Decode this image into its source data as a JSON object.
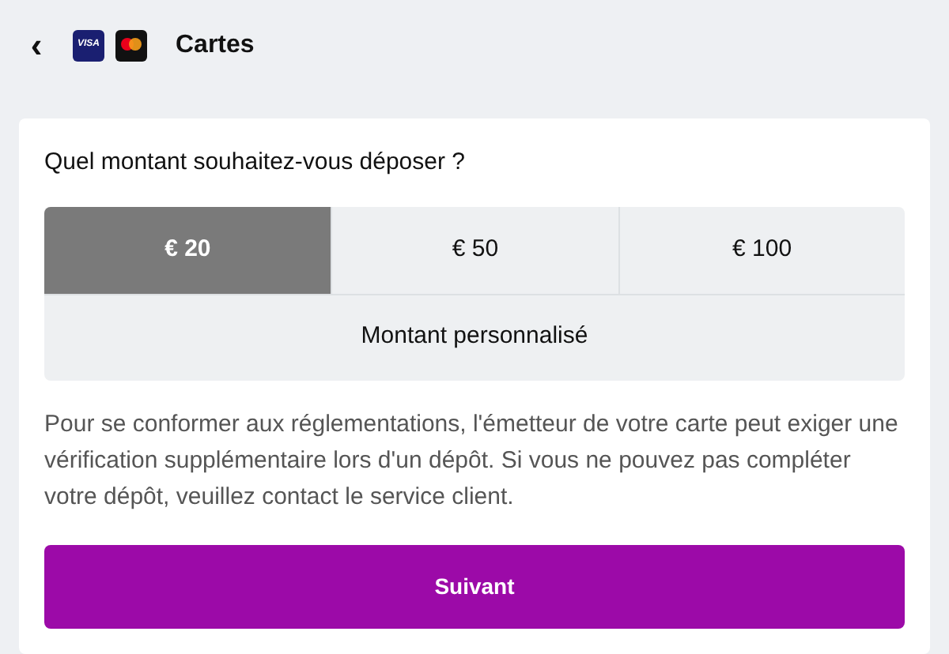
{
  "header": {
    "back": "‹",
    "brand_badge": "VISA",
    "title": "Cartes"
  },
  "question": "Quel montant souhaitez-vous déposer ?",
  "amounts": [
    {
      "label": "€ 20",
      "selected": true
    },
    {
      "label": "€ 50",
      "selected": false
    },
    {
      "label": "€ 100",
      "selected": false
    }
  ],
  "custom": {
    "label": "Montant personnalisé",
    "selected": false
  },
  "notice": "Pour se conformer aux réglementations, l'émetteur de votre carte peut exiger une vérification supplémentaire lors d'un dépôt. Si vous ne pouvez pas compléter votre dépôt, veuillez contact le service client.",
  "next_button": "Suivant"
}
